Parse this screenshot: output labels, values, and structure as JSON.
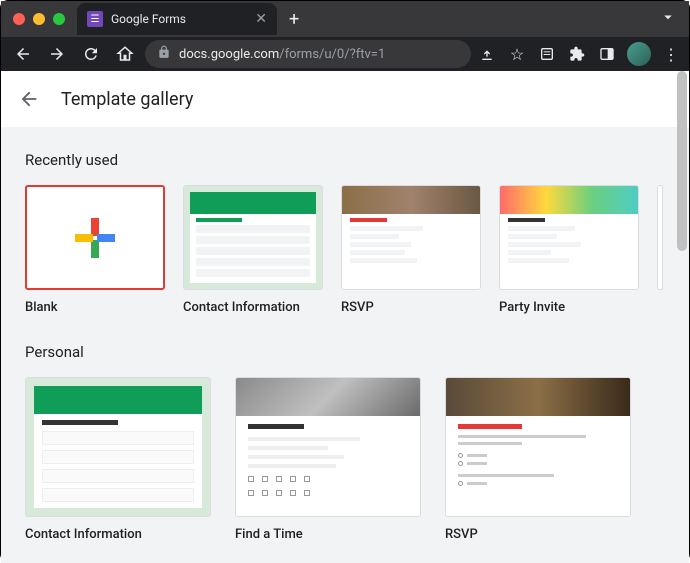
{
  "browser": {
    "tab_title": "Google Forms",
    "url_host": "docs.google.com",
    "url_path": "/forms/u/0/?ftv=1"
  },
  "page": {
    "title": "Template gallery"
  },
  "sections": {
    "recent": {
      "title": "Recently used",
      "templates": [
        {
          "label": "Blank"
        },
        {
          "label": "Contact Information"
        },
        {
          "label": "RSVP"
        },
        {
          "label": "Party Invite"
        }
      ]
    },
    "personal": {
      "title": "Personal",
      "templates": [
        {
          "label": "Contact Information"
        },
        {
          "label": "Find a Time"
        },
        {
          "label": "RSVP"
        }
      ]
    }
  },
  "colors": {
    "highlight": "#e53935",
    "forms_green": "#0f9d58"
  }
}
